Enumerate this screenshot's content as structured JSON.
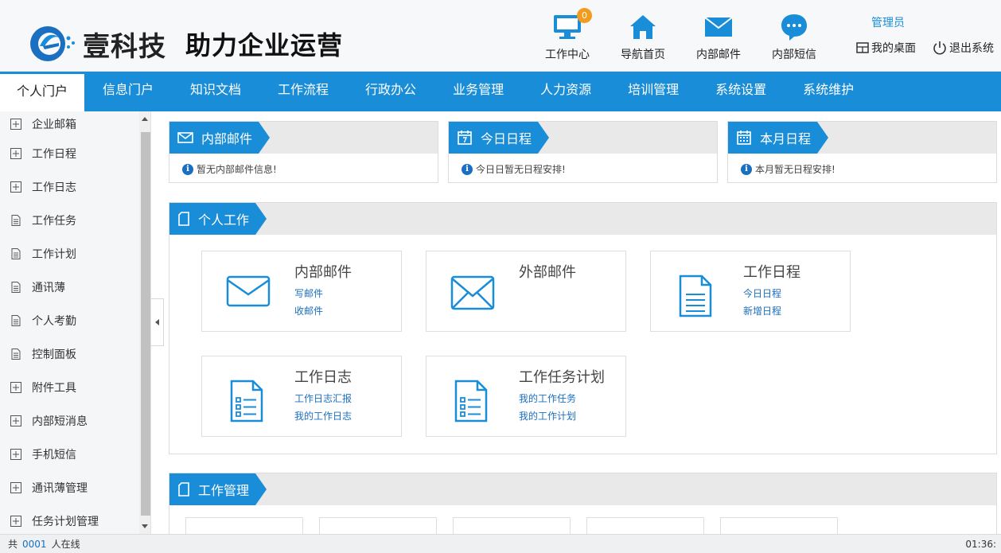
{
  "brand": {
    "name": "壹科技",
    "slogan": "助力企业运营"
  },
  "header_nav": [
    {
      "label": "工作中心",
      "icon": "monitor-icon",
      "badge": "0"
    },
    {
      "label": "导航首页",
      "icon": "home-icon"
    },
    {
      "label": "内部邮件",
      "icon": "mail-icon"
    },
    {
      "label": "内部短信",
      "icon": "chat-bubble-icon"
    }
  ],
  "user": {
    "role": "管理员",
    "desktop_label": "我的桌面",
    "logout_label": "退出系统"
  },
  "main_nav": [
    "个人门户",
    "信息门户",
    "知识文档",
    "工作流程",
    "行政办公",
    "业务管理",
    "人力资源",
    "培训管理",
    "系统设置",
    "系统维护"
  ],
  "sidebar": [
    {
      "label": "企业邮箱",
      "icon": "plus-box-icon"
    },
    {
      "label": "工作日程",
      "icon": "plus-box-icon"
    },
    {
      "label": "工作日志",
      "icon": "plus-box-icon"
    },
    {
      "label": "工作任务",
      "icon": "document-icon"
    },
    {
      "label": "工作计划",
      "icon": "document-icon"
    },
    {
      "label": "通讯薄",
      "icon": "document-icon"
    },
    {
      "label": "个人考勤",
      "icon": "document-icon"
    },
    {
      "label": "控制面板",
      "icon": "document-icon"
    },
    {
      "label": "附件工具",
      "icon": "plus-box-icon"
    },
    {
      "label": "内部短消息",
      "icon": "plus-box-icon"
    },
    {
      "label": "手机短信",
      "icon": "plus-box-icon"
    },
    {
      "label": "通讯薄管理",
      "icon": "plus-box-icon"
    },
    {
      "label": "任务计划管理",
      "icon": "plus-box-icon"
    }
  ],
  "top_panels": [
    {
      "title": "内部邮件",
      "icon": "mail-icon",
      "info": "暂无内部邮件信息!"
    },
    {
      "title": "今日日程",
      "icon": "calendar-day-icon",
      "info": "今日日暂无日程安排!"
    },
    {
      "title": "本月日程",
      "icon": "calendar-month-icon",
      "info": "本月暂无日程安排!"
    }
  ],
  "personal_work": {
    "title": "个人工作",
    "cards": [
      {
        "title": "内部邮件",
        "icon": "mail-icon",
        "links": [
          "写邮件",
          "收邮件"
        ]
      },
      {
        "title": "外部邮件",
        "icon": "mail-icon",
        "links": []
      },
      {
        "title": "工作日程",
        "icon": "document-icon",
        "links": [
          "今日日程",
          "新增日程"
        ]
      },
      {
        "title": "工作日志",
        "icon": "list-document-icon",
        "links": [
          "工作日志汇报",
          "我的工作日志"
        ]
      },
      {
        "title": "工作任务计划",
        "icon": "list-document-icon",
        "links": [
          "我的工作任务",
          "我的工作计划"
        ]
      }
    ]
  },
  "work_management": {
    "title": "工作管理"
  },
  "footer": {
    "prefix": "共",
    "online_count": "0001",
    "suffix": "人在线",
    "time": "01:36:"
  },
  "colors": {
    "primary": "#1a8dd8",
    "badge": "#f29c1f",
    "link": "#1a6fc0"
  }
}
